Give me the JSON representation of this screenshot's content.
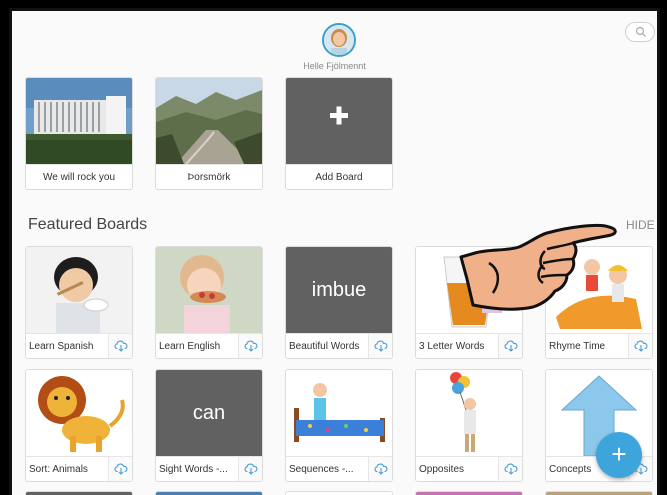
{
  "header": {
    "owner_name": "Helle Fjölmennt",
    "search_icon": "search-icon",
    "avatar_icon": "avatar"
  },
  "my_boards": [
    {
      "label": "We will rock you",
      "thumb": "building-photo"
    },
    {
      "label": "Þorsmörk",
      "thumb": "valley-photo"
    },
    {
      "label": "Add Board",
      "thumb": "plus-icon"
    }
  ],
  "featured": {
    "title": "Featured Boards",
    "hide_label": "HIDE",
    "boards": [
      {
        "label": "Learn Spanish",
        "thumb": "boy-eating-photo"
      },
      {
        "label": "Learn English",
        "thumb": "girl-eating-photo"
      },
      {
        "label": "Beautiful Words",
        "word": "imbue"
      },
      {
        "label": "3 Letter Words",
        "thumb": "juice-glass"
      },
      {
        "label": "Rhyme Time",
        "thumb": "kids-cartoon"
      },
      {
        "label": "Sort: Animals",
        "thumb": "lion-cartoon"
      },
      {
        "label": "Sight Words -...",
        "word": "can"
      },
      {
        "label": "Sequences -...",
        "thumb": "bed-cartoon"
      },
      {
        "label": "Opposites",
        "thumb": "balloon-man-cartoon"
      },
      {
        "label": "Concepts",
        "thumb": "up-arrow"
      }
    ]
  },
  "fab": {
    "label": "+"
  },
  "colors": {
    "accent": "#3ea4dc",
    "tile": "#616161",
    "hand": "#f0b08a"
  }
}
